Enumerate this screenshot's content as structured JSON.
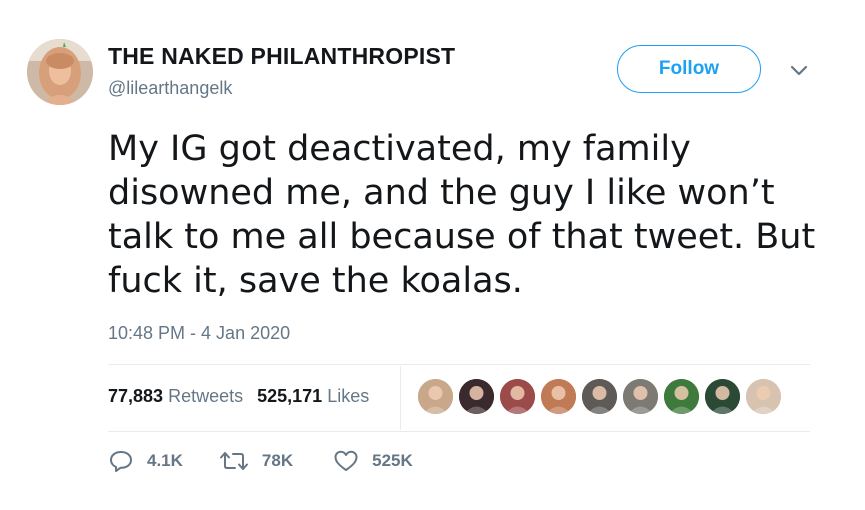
{
  "user": {
    "display_name": "THE NAKED PHILANTHROPIST",
    "handle": "@lilearthangelk",
    "follow_label": "Follow"
  },
  "tweet": {
    "text": "My IG got deactivated, my family\ndisowned me, and the guy I like won’t\ntalk to me all because of that tweet. But\nfuck it, save the koalas.",
    "timestamp": "10:48 PM - 4 Jan 2020"
  },
  "stats": {
    "retweets_count": "77,883",
    "retweets_label": "Retweets",
    "likes_count": "525,171",
    "likes_label": "Likes"
  },
  "likers": [
    {
      "name": "liker-avatar-1",
      "color": "#c8a78a"
    },
    {
      "name": "liker-avatar-2",
      "color": "#3a2a2e"
    },
    {
      "name": "liker-avatar-3",
      "color": "#9b4b4a"
    },
    {
      "name": "liker-avatar-4",
      "color": "#c07a55"
    },
    {
      "name": "liker-avatar-5",
      "color": "#5d5a58"
    },
    {
      "name": "liker-avatar-6",
      "color": "#7d7a74"
    },
    {
      "name": "liker-avatar-7",
      "color": "#3e7a3c"
    },
    {
      "name": "liker-avatar-8",
      "color": "#2b4a36"
    },
    {
      "name": "liker-avatar-9",
      "color": "#d8c2b0"
    }
  ],
  "actions": {
    "reply_count": "4.1K",
    "retweet_count": "78K",
    "like_count": "525K"
  },
  "colors": {
    "accent": "#1da1f2",
    "text": "#14171a",
    "muted": "#657786",
    "divider": "#e6ecf0"
  },
  "icons": {
    "reply": "reply-icon",
    "retweet": "retweet-icon",
    "like": "heart-icon",
    "caret": "chevron-down-icon"
  }
}
